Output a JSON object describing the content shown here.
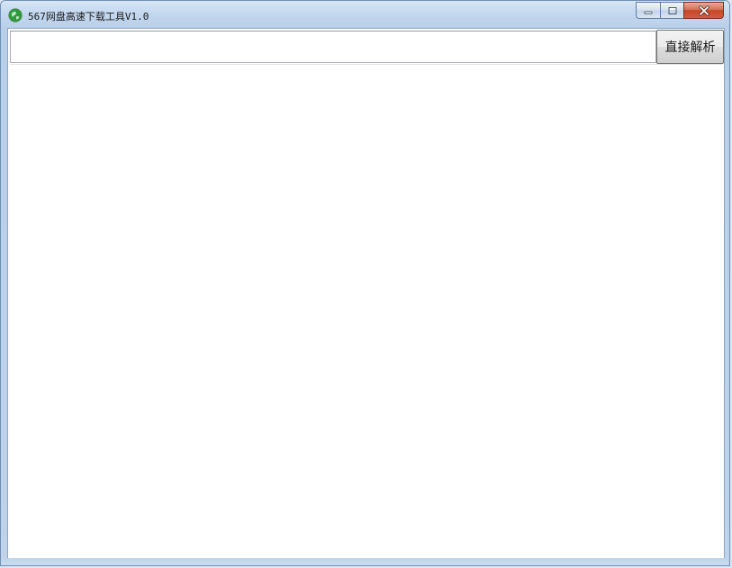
{
  "window": {
    "title": "567网盘高速下载工具V1.0",
    "icon": "green-globe-icon"
  },
  "caption": {
    "minimize_icon": "minimize-icon",
    "maximize_icon": "maximize-icon",
    "close_icon": "close-icon"
  },
  "toolbar": {
    "url_value": "",
    "url_placeholder": "",
    "parse_button_label": "直接解析"
  },
  "colors": {
    "accent_close": "#c7452a",
    "frame": "#bfd3ea",
    "icon_green": "#2e9b3a"
  }
}
